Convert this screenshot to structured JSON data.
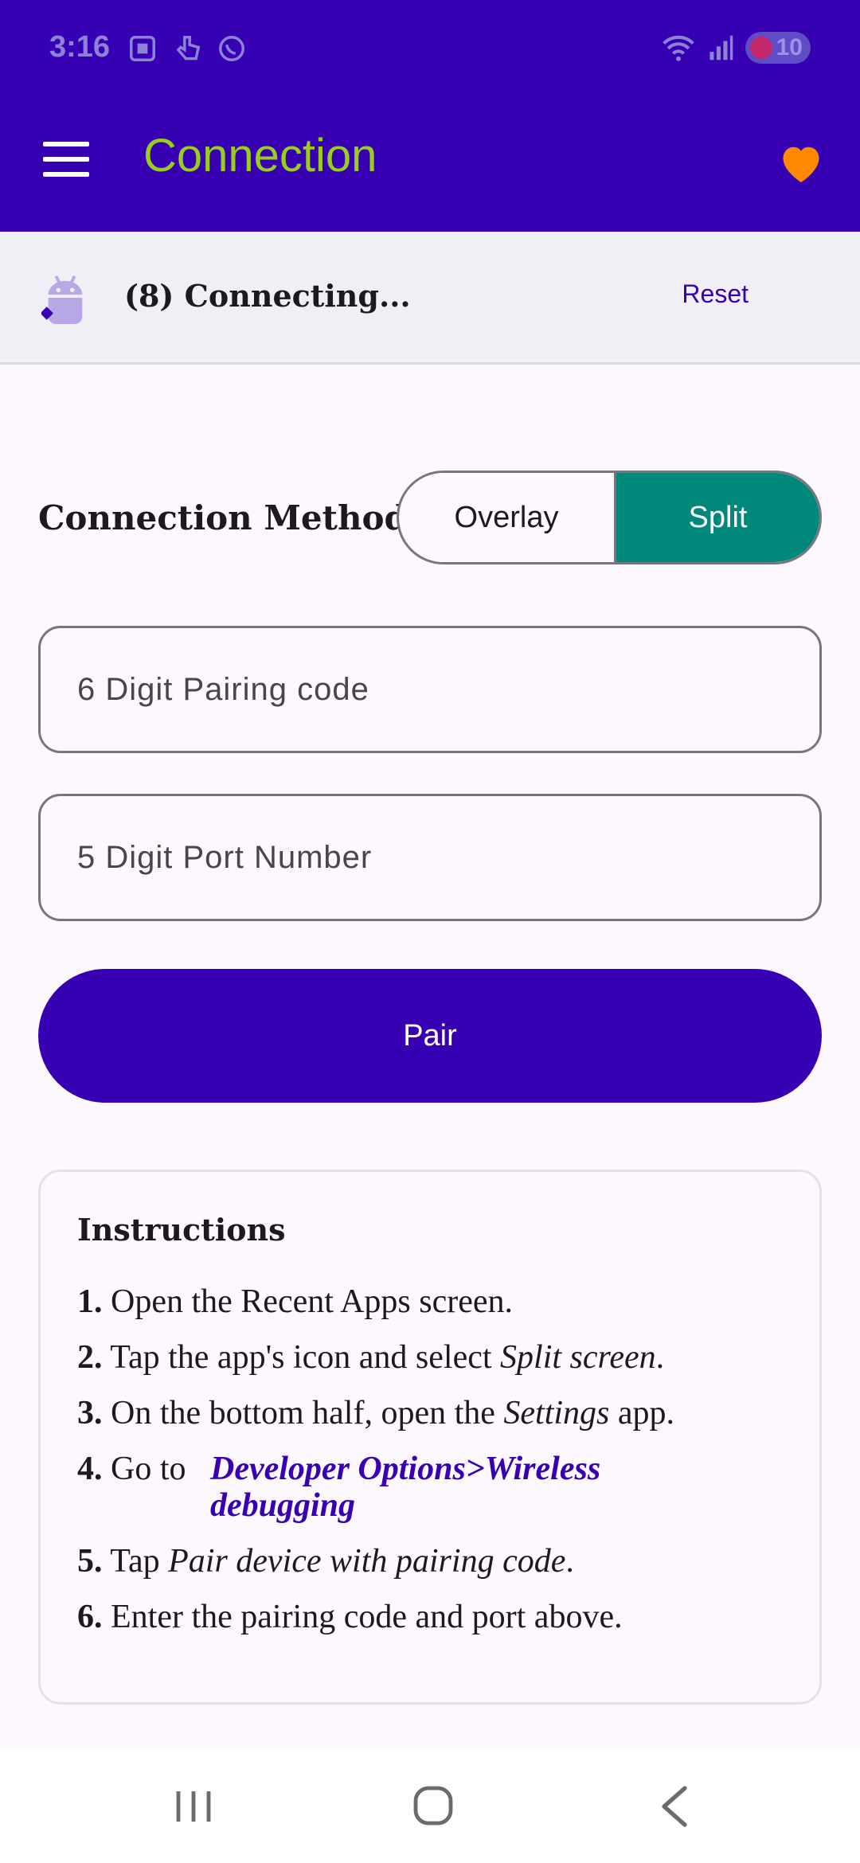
{
  "status_bar": {
    "time": "3:16",
    "battery": "10"
  },
  "app_bar": {
    "title": "Connection",
    "menu_icon": "hamburger-menu-icon",
    "favorite_icon": "heart-icon"
  },
  "connection": {
    "status": "(8) Connecting...",
    "reset_label": "Reset"
  },
  "method": {
    "label": "Connection Method",
    "options": [
      "Overlay",
      "Split"
    ],
    "selected": "Split"
  },
  "inputs": {
    "pairing_code_placeholder": "6 Digit Pairing code",
    "port_placeholder": "5 Digit Port Number"
  },
  "pair_button": "Pair",
  "instructions": {
    "title": "Instructions",
    "steps": [
      {
        "num": "1.",
        "text": "Open the Recent Apps screen."
      },
      {
        "num": "2.",
        "pre": "Tap the app's icon and select ",
        "em": "Split screen",
        "post": "."
      },
      {
        "num": "3.",
        "pre": "On the bottom half, open the ",
        "em": "Settings",
        "post": " app."
      },
      {
        "num": "4.",
        "pre": "Go to ",
        "link": "Developer Options>Wireless debugging"
      },
      {
        "num": "5.",
        "pre": "Tap ",
        "em": "Pair device with pairing code",
        "post": "."
      },
      {
        "num": "6.",
        "text": "Enter the pairing code and port above."
      }
    ]
  },
  "colors": {
    "primary": "#3700b3",
    "title": "#9acd1f",
    "split_selected": "#00897b",
    "heart": "#ff8a00"
  }
}
